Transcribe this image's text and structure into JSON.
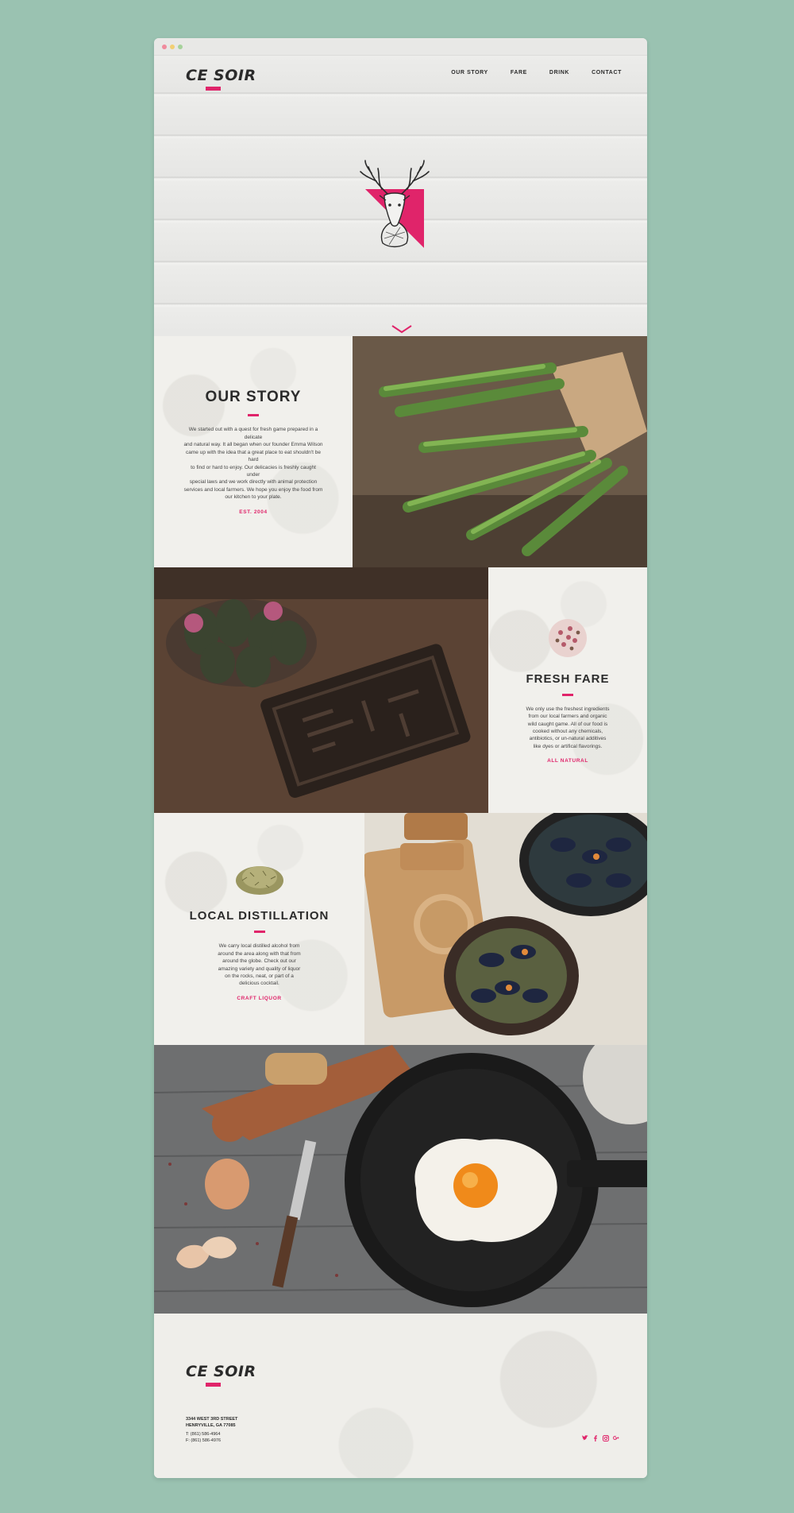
{
  "window": {
    "traffic_lights": [
      "close",
      "minimize",
      "maximize"
    ]
  },
  "header": {
    "logo": "CE SOIR",
    "nav": [
      "OUR STORY",
      "FARE",
      "DRINK",
      "CONTACT"
    ]
  },
  "hero": {
    "emblem": "deer-head-icon",
    "scroll_cue": "chevron-down-icon"
  },
  "sections": {
    "story": {
      "title": "OUR STORY",
      "body": "We started out with a quest for fresh game prepared in a delicate\nand natural way. It all began when our founder Emma Wilson\ncame up with the idea that a great place to eat shouldn't be hard\nto find or hard to enjoy. Our delicacies is freshly caught under\nspecial laws and we work directly with animal protection\nservices and local farmers. We hope you enjoy the food from\nour kitchen to your plate.",
      "tag": "EST. 2004"
    },
    "fare": {
      "title": "FRESH FARE",
      "body": "We only use the freshest ingredients\nfrom our local farmers and organic\nwild caught game. All of our food is\ncooked without any chemicals,\nantibiotics, or un-natural additives\nlike dyes or artifical flavorings.",
      "tag": "ALL NATURAL"
    },
    "distillation": {
      "title": "LOCAL DISTILLATION",
      "body": "We carry local distilled alcohol from\naround the area along with that from\naround the globe. Check out our\namazing variety and quality of liquor\non the rocks, neat, or part of a\ndelicious cocktail.",
      "tag": "CRAFT LIQUOR"
    }
  },
  "footer": {
    "logo": "CE SOIR",
    "address_line1": "3344 WEST 3RD STREET",
    "address_line2": "HENRYVILLE, GA 77085",
    "phone": "T: (861) 586-4964",
    "fax": "F: (861) 586-4976",
    "social": [
      "twitter-icon",
      "facebook-icon",
      "instagram-icon",
      "google-plus-icon"
    ]
  },
  "colors": {
    "accent": "#e0246a",
    "background": "#9ac2b1",
    "panel": "#f1f0ec",
    "text": "#2b2b2b"
  }
}
